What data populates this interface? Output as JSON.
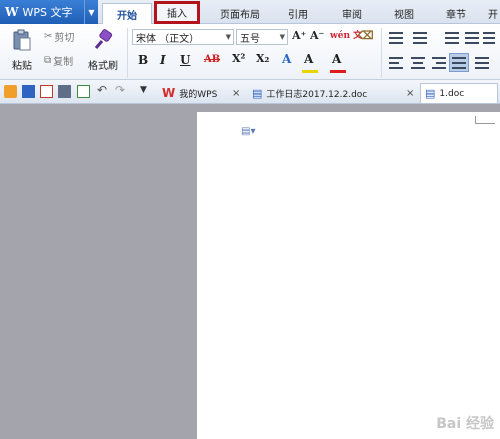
{
  "app": {
    "logo": "W",
    "name": "WPS 文字"
  },
  "tabs": [
    {
      "label": "开始"
    },
    {
      "label": "插入"
    },
    {
      "label": "页面布局"
    },
    {
      "label": "引用"
    },
    {
      "label": "审阅"
    },
    {
      "label": "视图"
    },
    {
      "label": "章节"
    },
    {
      "label": "开"
    }
  ],
  "ribbon": {
    "paste": "粘贴",
    "cut": "剪切",
    "copy": "复制",
    "format_painter": "格式刷",
    "font_name": "宋体 （正文）",
    "font_size": "五号",
    "bold": "B",
    "italic": "I",
    "underline": "U",
    "strike": "AB",
    "superscript": "X²",
    "subscript": "X₂",
    "grow": "A⁺",
    "shrink": "A⁻",
    "phonetic": "wén 文",
    "font_color": "A",
    "highlight": "A"
  },
  "doc_tabs": [
    {
      "label": "我的WPS"
    },
    {
      "label": "工作日志2017.12.2.doc"
    },
    {
      "label": "1.doc"
    }
  ],
  "watermark": "Bai 经验",
  "colors": {
    "accent": "#1f5fb6",
    "highlight_border": "#b3141b",
    "font_color_bar": "#e01b1b"
  }
}
